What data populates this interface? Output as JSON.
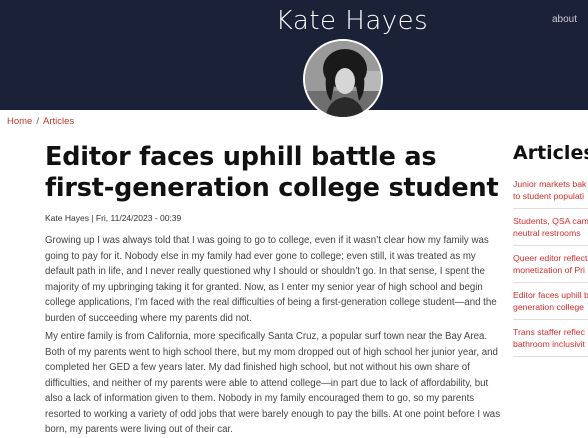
{
  "site": {
    "title": "Kate Hayes",
    "about_label": "about"
  },
  "breadcrumb": {
    "home": "Home",
    "separator": "/",
    "current": "Articles"
  },
  "article": {
    "title": "Editor faces uphill battle as first-generation college student",
    "byline": "Kate Hayes | Fri, 11/24/2023 - 00:39",
    "paragraphs": [
      "Growing up I was always told that I was going to go to college, even if it wasn’t clear how my family was going to pay for it. Nobody else in my family had ever gone to college; even still, it was treated as my default path in life, and I never really questioned why I should or shouldn’t go. In that sense, I spent the majority of my upbringing taking it for granted. Now, as I enter my senior year of high school and begin college applications, I’m faced with the real difficulties of being a first-generation college student—and the burden of succeeding where my parents did not.",
      "My entire family is from California, more specifically Santa Cruz, a popular surf town near the Bay Area. Both of my parents went to high school there, but my mom dropped out of high school her junior year, and completed her GED a few years later. My dad finished high school, but not without his own share of difficulties, and neither of my parents were able to attend college—in part due to lack of affordability, but also a lack of information given to them. Nobody in my family encouraged them to go, so my parents resorted to working a variety of odd jobs that were barely enough to pay the bills. At one point before I was born, my parents were living out of their car."
    ]
  },
  "sidebar": {
    "heading": "Articles",
    "items": [
      {
        "line1": "Junior markets bak",
        "line2": "to student populati"
      },
      {
        "line1": "Students, QSA cam",
        "line2": "neutral restrooms"
      },
      {
        "line1": "Queer editor reflect",
        "line2": "monetization of Pri"
      },
      {
        "line1": "Editor faces uphill b",
        "line2": "generation college"
      },
      {
        "line1": "Trans staffer reflec",
        "line2": "bathroom inclusivit"
      }
    ]
  },
  "colors": {
    "header_bg": "#1b2137",
    "link": "#d62c2c",
    "breadcrumb": "#c0392b"
  },
  "icons": {
    "avatar": "profile-photo-avatar"
  }
}
